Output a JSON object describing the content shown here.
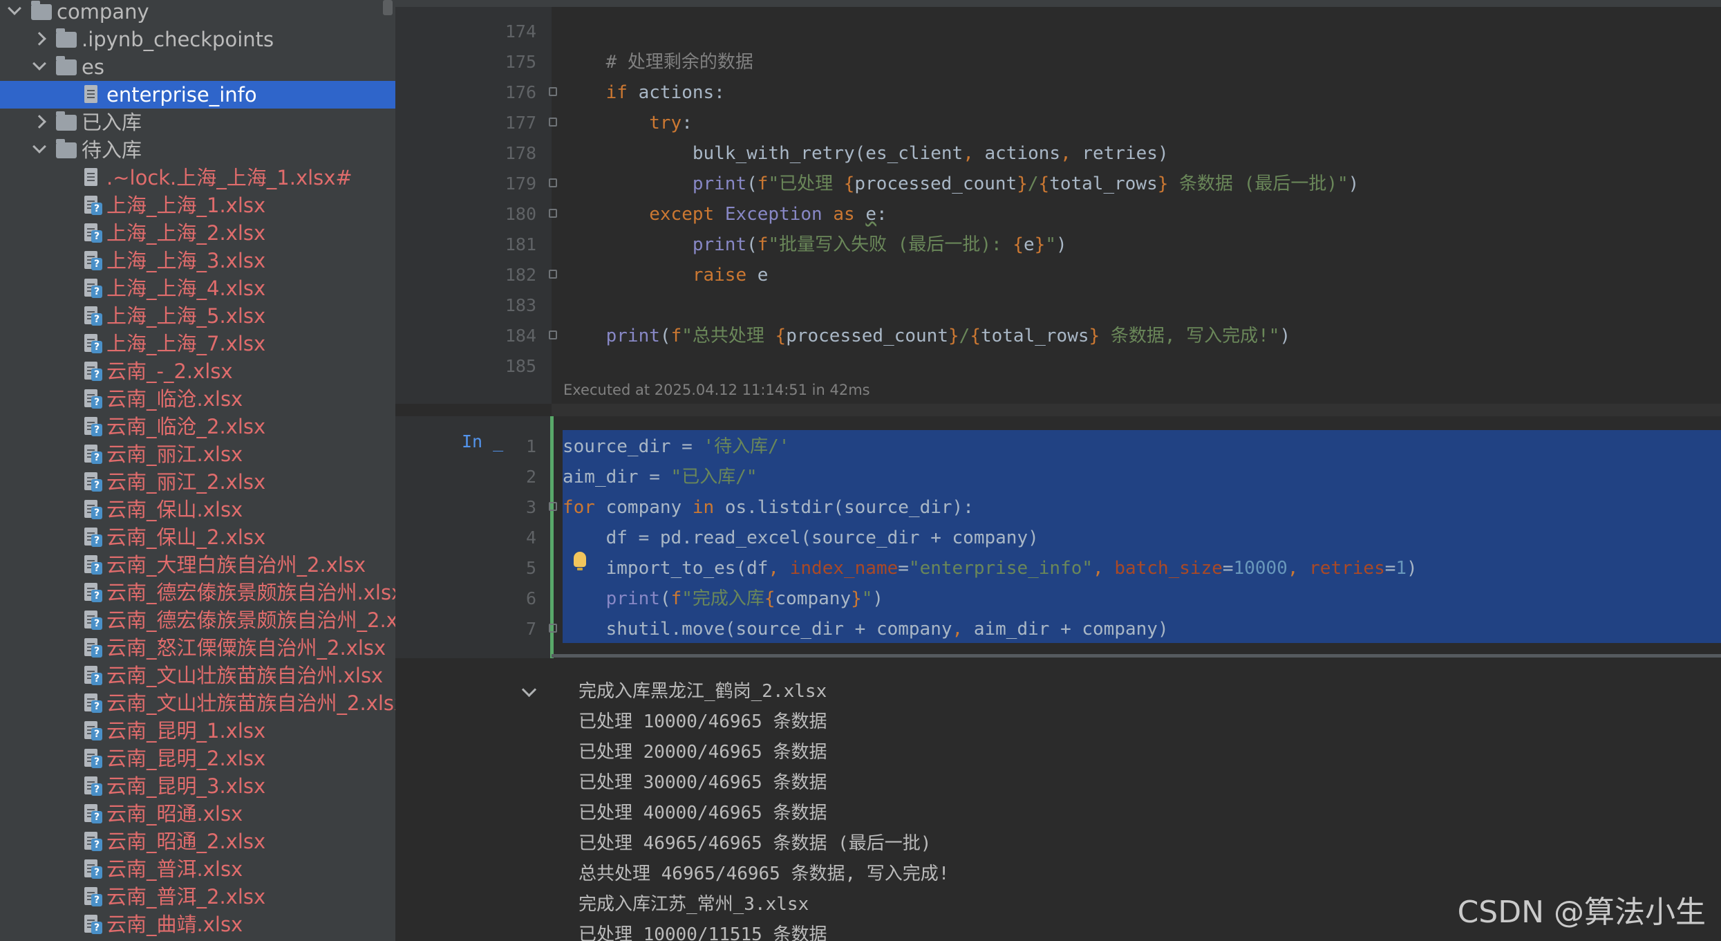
{
  "project_tree": {
    "items": [
      {
        "label": "company",
        "type": "folder",
        "expanded": true,
        "depth": 0
      },
      {
        "label": ".ipynb_checkpoints",
        "type": "folder",
        "expanded": false,
        "depth": 1
      },
      {
        "label": "es",
        "type": "folder",
        "expanded": true,
        "depth": 1
      },
      {
        "label": "enterprise_info",
        "type": "file",
        "depth": 2,
        "selected": true
      },
      {
        "label": "已入库",
        "type": "folder",
        "expanded": false,
        "depth": 1
      },
      {
        "label": "待入库",
        "type": "folder",
        "expanded": true,
        "depth": 1
      },
      {
        "label": ".~lock.上海_上海_1.xlsx#",
        "type": "file",
        "depth": 2,
        "untracked": true
      },
      {
        "label": "上海_上海_1.xlsx",
        "type": "unknown-file",
        "depth": 2,
        "untracked": true
      },
      {
        "label": "上海_上海_2.xlsx",
        "type": "unknown-file",
        "depth": 2,
        "untracked": true
      },
      {
        "label": "上海_上海_3.xlsx",
        "type": "unknown-file",
        "depth": 2,
        "untracked": true
      },
      {
        "label": "上海_上海_4.xlsx",
        "type": "unknown-file",
        "depth": 2,
        "untracked": true
      },
      {
        "label": "上海_上海_5.xlsx",
        "type": "unknown-file",
        "depth": 2,
        "untracked": true
      },
      {
        "label": "上海_上海_7.xlsx",
        "type": "unknown-file",
        "depth": 2,
        "untracked": true
      },
      {
        "label": "云南_-_2.xlsx",
        "type": "unknown-file",
        "depth": 2,
        "untracked": true
      },
      {
        "label": "云南_临沧.xlsx",
        "type": "unknown-file",
        "depth": 2,
        "untracked": true
      },
      {
        "label": "云南_临沧_2.xlsx",
        "type": "unknown-file",
        "depth": 2,
        "untracked": true
      },
      {
        "label": "云南_丽江.xlsx",
        "type": "unknown-file",
        "depth": 2,
        "untracked": true
      },
      {
        "label": "云南_丽江_2.xlsx",
        "type": "unknown-file",
        "depth": 2,
        "untracked": true
      },
      {
        "label": "云南_保山.xlsx",
        "type": "unknown-file",
        "depth": 2,
        "untracked": true
      },
      {
        "label": "云南_保山_2.xlsx",
        "type": "unknown-file",
        "depth": 2,
        "untracked": true
      },
      {
        "label": "云南_大理白族自治州_2.xlsx",
        "type": "unknown-file",
        "depth": 2,
        "untracked": true
      },
      {
        "label": "云南_德宏傣族景颇族自治州.xlsx",
        "type": "unknown-file",
        "depth": 2,
        "untracked": true
      },
      {
        "label": "云南_德宏傣族景颇族自治州_2.xlsx",
        "type": "unknown-file",
        "depth": 2,
        "untracked": true
      },
      {
        "label": "云南_怒江傈僳族自治州_2.xlsx",
        "type": "unknown-file",
        "depth": 2,
        "untracked": true
      },
      {
        "label": "云南_文山壮族苗族自治州.xlsx",
        "type": "unknown-file",
        "depth": 2,
        "untracked": true
      },
      {
        "label": "云南_文山壮族苗族自治州_2.xlsx",
        "type": "unknown-file",
        "depth": 2,
        "untracked": true
      },
      {
        "label": "云南_昆明_1.xlsx",
        "type": "unknown-file",
        "depth": 2,
        "untracked": true
      },
      {
        "label": "云南_昆明_2.xlsx",
        "type": "unknown-file",
        "depth": 2,
        "untracked": true
      },
      {
        "label": "云南_昆明_3.xlsx",
        "type": "unknown-file",
        "depth": 2,
        "untracked": true
      },
      {
        "label": "云南_昭通.xlsx",
        "type": "unknown-file",
        "depth": 2,
        "untracked": true
      },
      {
        "label": "云南_昭通_2.xlsx",
        "type": "unknown-file",
        "depth": 2,
        "untracked": true
      },
      {
        "label": "云南_普洱.xlsx",
        "type": "unknown-file",
        "depth": 2,
        "untracked": true
      },
      {
        "label": "云南_普洱_2.xlsx",
        "type": "unknown-file",
        "depth": 2,
        "untracked": true
      },
      {
        "label": "云南_曲靖.xlsx",
        "type": "unknown-file",
        "depth": 2,
        "untracked": true
      }
    ]
  },
  "cell1": {
    "lines": [
      {
        "num": "174",
        "segments": []
      },
      {
        "num": "175",
        "segments": [
          [
            "",
            "    "
          ],
          [
            "cm",
            "# 处理剩余的数据"
          ]
        ]
      },
      {
        "num": "176",
        "segments": [
          [
            "",
            "    "
          ],
          [
            "kw",
            "if"
          ],
          [
            "",
            " actions:"
          ]
        ]
      },
      {
        "num": "177",
        "segments": [
          [
            "",
            "        "
          ],
          [
            "kw",
            "try"
          ],
          [
            "",
            ":"
          ]
        ]
      },
      {
        "num": "178",
        "segments": [
          [
            "",
            "            bulk_with_retry(es_client"
          ],
          [
            "kw",
            ","
          ],
          [
            "",
            " actions"
          ],
          [
            "kw",
            ","
          ],
          [
            "",
            " retries)"
          ]
        ]
      },
      {
        "num": "179",
        "segments": [
          [
            "",
            "            "
          ],
          [
            "fn",
            "print"
          ],
          [
            "",
            "("
          ],
          [
            "kw",
            "f"
          ],
          [
            "str",
            "\"已处理 "
          ],
          [
            "brace",
            "{"
          ],
          [
            "",
            "processed_count"
          ],
          [
            "brace",
            "}"
          ],
          [
            "str",
            "/"
          ],
          [
            "brace",
            "{"
          ],
          [
            "",
            "total_rows"
          ],
          [
            "brace",
            "}"
          ],
          [
            "str",
            " 条数据 (最后一批)\""
          ],
          [
            "",
            ")"
          ]
        ]
      },
      {
        "num": "180",
        "segments": [
          [
            "",
            "        "
          ],
          [
            "kw",
            "except"
          ],
          [
            "",
            " "
          ],
          [
            "fn",
            "Exception"
          ],
          [
            "",
            " "
          ],
          [
            "kw",
            "as"
          ],
          [
            "",
            " "
          ],
          [
            "ul",
            "e"
          ],
          [
            "",
            ":"
          ]
        ]
      },
      {
        "num": "181",
        "segments": [
          [
            "",
            "            "
          ],
          [
            "fn",
            "print"
          ],
          [
            "",
            "("
          ],
          [
            "kw",
            "f"
          ],
          [
            "str",
            "\"批量写入失败 (最后一批): "
          ],
          [
            "brace",
            "{"
          ],
          [
            "",
            "e"
          ],
          [
            "brace",
            "}"
          ],
          [
            "str",
            "\""
          ],
          [
            "",
            ")"
          ]
        ]
      },
      {
        "num": "182",
        "segments": [
          [
            "",
            "            "
          ],
          [
            "kw",
            "raise"
          ],
          [
            "",
            " e"
          ]
        ]
      },
      {
        "num": "183",
        "segments": []
      },
      {
        "num": "184",
        "segments": [
          [
            "",
            "    "
          ],
          [
            "fn",
            "print"
          ],
          [
            "",
            "("
          ],
          [
            "kw",
            "f"
          ],
          [
            "str",
            "\"总共处理 "
          ],
          [
            "brace",
            "{"
          ],
          [
            "",
            "processed_count"
          ],
          [
            "brace",
            "}"
          ],
          [
            "str",
            "/"
          ],
          [
            "brace",
            "{"
          ],
          [
            "",
            "total_rows"
          ],
          [
            "brace",
            "}"
          ],
          [
            "str",
            " 条数据, 写入完成!\""
          ],
          [
            "",
            ")"
          ]
        ]
      },
      {
        "num": "185",
        "segments": []
      }
    ],
    "exec_info": "Executed at 2025.04.12 11:14:51 in 42ms"
  },
  "cell2": {
    "in_marker": "In _",
    "lines": [
      {
        "num": "1",
        "segments": [
          [
            "",
            "source_dir = "
          ],
          [
            "str",
            "'待入库/'"
          ]
        ]
      },
      {
        "num": "2",
        "segments": [
          [
            "",
            "aim_dir = "
          ],
          [
            "str",
            "\"已入库/\""
          ]
        ]
      },
      {
        "num": "3",
        "segments": [
          [
            "kw",
            "for"
          ],
          [
            "",
            " company "
          ],
          [
            "kw",
            "in"
          ],
          [
            "",
            " os.listdir(source_dir):"
          ]
        ]
      },
      {
        "num": "4",
        "segments": [
          [
            "",
            "    df = pd.read_excel(source_dir + company)"
          ]
        ]
      },
      {
        "num": "5",
        "segments": [
          [
            "",
            "    import_to_es(df"
          ],
          [
            "kw",
            ","
          ],
          [
            "",
            " "
          ],
          [
            "param",
            "index_name"
          ],
          [
            "",
            "="
          ],
          [
            "str",
            "\"enterprise_info\""
          ],
          [
            "kw",
            ","
          ],
          [
            "",
            " "
          ],
          [
            "param",
            "batch_size"
          ],
          [
            "",
            "="
          ],
          [
            "num",
            "10000"
          ],
          [
            "kw",
            ","
          ],
          [
            "",
            " "
          ],
          [
            "param",
            "retries"
          ],
          [
            "",
            "="
          ],
          [
            "num",
            "1"
          ],
          [
            "",
            ")"
          ]
        ]
      },
      {
        "num": "6",
        "segments": [
          [
            "",
            "    "
          ],
          [
            "fn",
            "print"
          ],
          [
            "",
            "("
          ],
          [
            "kw",
            "f"
          ],
          [
            "str",
            "\"完成入库"
          ],
          [
            "brace",
            "{"
          ],
          [
            "",
            "company"
          ],
          [
            "brace",
            "}"
          ],
          [
            "str",
            "\""
          ],
          [
            "",
            ")"
          ]
        ]
      },
      {
        "num": "7",
        "segments": [
          [
            "",
            "    shutil.move(source_dir + company"
          ],
          [
            "kw",
            ","
          ],
          [
            "",
            " aim_dir + company)"
          ]
        ]
      }
    ]
  },
  "output": {
    "lines": [
      "完成入库黑龙江_鹤岗_2.xlsx",
      "已处理 10000/46965 条数据",
      "已处理 20000/46965 条数据",
      "已处理 30000/46965 条数据",
      "已处理 40000/46965 条数据",
      "已处理 46965/46965 条数据 (最后一批)",
      "总共处理 46965/46965 条数据, 写入完成!",
      "完成入库江苏_常州_3.xlsx",
      "已处理 10000/11515 条数据"
    ]
  },
  "watermark": "CSDN @算法小生",
  "colors": {
    "selection": "#214283",
    "tree_selection": "#2f65ca",
    "untracked_file": "#e06c6c",
    "cell_active_bar": "#59a869"
  }
}
